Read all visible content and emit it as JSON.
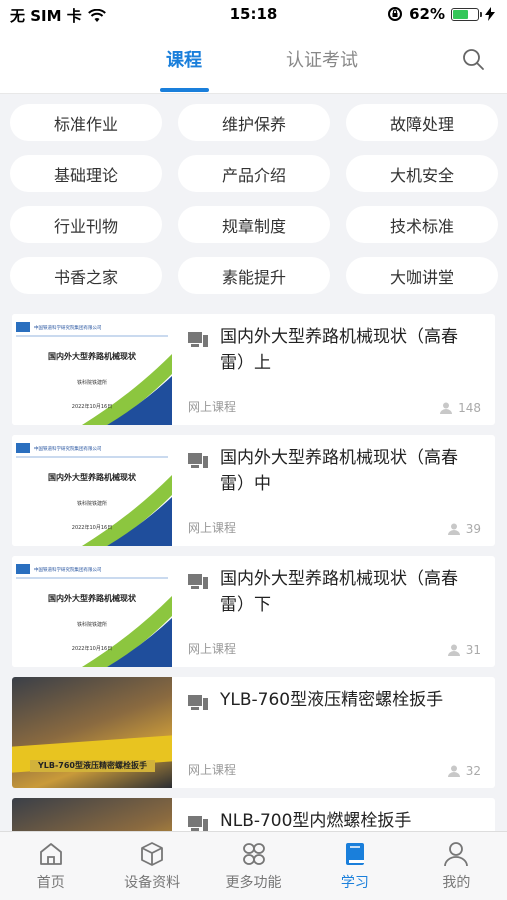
{
  "status_bar": {
    "carrier": "无 SIM 卡",
    "time": "15:18",
    "battery": "62%",
    "battery_level": 0.62
  },
  "header": {
    "tabs": [
      {
        "label": "课程",
        "active": true
      },
      {
        "label": "认证考试",
        "active": false
      }
    ]
  },
  "categories": [
    "标准作业",
    "维护保养",
    "故障处理",
    "基础理论",
    "产品介绍",
    "大机安全",
    "行业刊物",
    "规章制度",
    "技术标准",
    "书香之家",
    "素能提升",
    "大咖讲堂"
  ],
  "courses": [
    {
      "title": "国内外大型养路机械现状（高春雷）上",
      "type": "网上课程",
      "views": "148",
      "thumb": {
        "kind": "slide",
        "org": "中国铁道科学研究院集团有限公司",
        "heading": "国内外大型养路机械现状",
        "sub": "铁科院铁建所",
        "date": "2022年10月16日"
      }
    },
    {
      "title": "国内外大型养路机械现状（高春雷）中",
      "type": "网上课程",
      "views": "39",
      "thumb": {
        "kind": "slide",
        "org": "中国铁道科学研究院集团有限公司",
        "heading": "国内外大型养路机械现状",
        "sub": "铁科院铁建所",
        "date": "2022年10月16日"
      }
    },
    {
      "title": "国内外大型养路机械现状（高春雷）下",
      "type": "网上课程",
      "views": "31",
      "thumb": {
        "kind": "slide",
        "org": "中国铁道科学研究院集团有限公司",
        "heading": "国内外大型养路机械现状",
        "sub": "铁科院铁建所",
        "date": "2022年10月16日"
      }
    },
    {
      "title": "YLB-760型液压精密螺栓扳手",
      "type": "网上课程",
      "views": "32",
      "thumb": {
        "kind": "photo",
        "caption": "YLB-760型液压精密螺栓扳手"
      }
    },
    {
      "title": "NLB-700型内燃螺栓扳手",
      "type": "",
      "views": "",
      "thumb": {
        "kind": "photo",
        "caption": ""
      }
    }
  ],
  "tabbar": [
    {
      "label": "首页",
      "icon": "home-icon",
      "active": false
    },
    {
      "label": "设备资料",
      "icon": "cube-icon",
      "active": false
    },
    {
      "label": "更多功能",
      "icon": "grid-icon",
      "active": false
    },
    {
      "label": "学习",
      "icon": "book-icon",
      "active": true
    },
    {
      "label": "我的",
      "icon": "user-icon",
      "active": false
    }
  ],
  "colors": {
    "accent": "#1a7fdb",
    "background": "#f2f3f6",
    "slide_green": "#8cc63f",
    "slide_blue": "#1f4e9c"
  }
}
